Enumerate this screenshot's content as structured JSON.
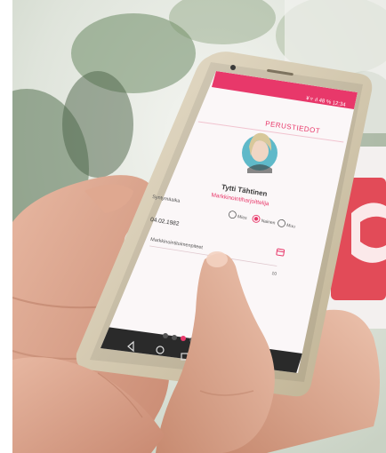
{
  "screen": {
    "status_bar": "¥ ▿  ıl 48 %  12:34",
    "title": "PERUSTIEDOT",
    "profile_name": "Tytti Tähtinen",
    "profile_role": "Markkinointiharjoittelija",
    "field_birthdate_label": "Syntymäaika",
    "gender_options": [
      "Mies",
      "Nainen",
      "Muu"
    ],
    "gender_selected": "Nainen",
    "field_birthdate_value": "04.02.1982",
    "field_marketing_label": "Markkinointitoimenpiteet",
    "field_marketing_value": "10",
    "pager": {
      "count": 4,
      "active": 2
    }
  },
  "colors": {
    "accent": "#e8386a",
    "card_red": "#e24b58",
    "device_body": "#d8cdb6",
    "nav_bar": "#2a2a2a"
  },
  "icons": [
    "calendar-icon",
    "back-nav-icon",
    "home-nav-icon",
    "recents-nav-icon"
  ]
}
